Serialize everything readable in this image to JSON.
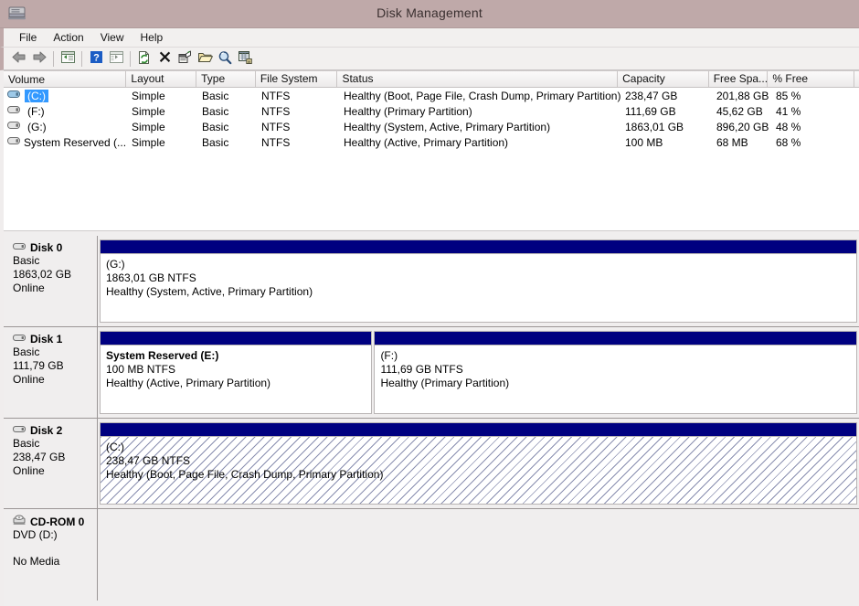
{
  "window": {
    "title": "Disk Management",
    "app_icon": "disk-management-icon"
  },
  "menubar": {
    "items": [
      {
        "label": "File",
        "name": "menu-file"
      },
      {
        "label": "Action",
        "name": "menu-action"
      },
      {
        "label": "View",
        "name": "menu-view"
      },
      {
        "label": "Help",
        "name": "menu-help"
      }
    ]
  },
  "toolbar": {
    "buttons": [
      {
        "icon": "back-arrow-icon",
        "name": "toolbar-back"
      },
      {
        "icon": "forward-arrow-icon",
        "name": "toolbar-forward"
      },
      {
        "sep": true
      },
      {
        "icon": "show-hide-tree-icon",
        "name": "toolbar-show-tree"
      },
      {
        "sep": true
      },
      {
        "icon": "help-icon",
        "name": "toolbar-help"
      },
      {
        "icon": "show-action-pane-icon",
        "name": "toolbar-action-pane"
      },
      {
        "sep": true
      },
      {
        "icon": "rescan-disks-icon",
        "name": "toolbar-rescan"
      },
      {
        "icon": "delete-icon",
        "name": "toolbar-delete"
      },
      {
        "icon": "properties-icon",
        "name": "toolbar-properties"
      },
      {
        "icon": "open-folder-icon",
        "name": "toolbar-open"
      },
      {
        "icon": "search-icon",
        "name": "toolbar-search"
      },
      {
        "icon": "export-list-icon",
        "name": "toolbar-export-list"
      }
    ]
  },
  "volume_list": {
    "columns": [
      {
        "label": "Volume",
        "name": "column-volume"
      },
      {
        "label": "Layout",
        "name": "column-layout"
      },
      {
        "label": "Type",
        "name": "column-type"
      },
      {
        "label": "File System",
        "name": "column-file-system"
      },
      {
        "label": "Status",
        "name": "column-status"
      },
      {
        "label": "Capacity",
        "name": "column-capacity"
      },
      {
        "label": "Free Spa...",
        "name": "column-free-space"
      },
      {
        "label": "% Free",
        "name": "column-percent-free"
      },
      {
        "label": "",
        "name": "column-filler"
      }
    ],
    "rows": [
      {
        "volume": "(C:)",
        "selected": true,
        "layout": "Simple",
        "type": "Basic",
        "file_system": "NTFS",
        "status": "Healthy (Boot, Page File, Crash Dump, Primary Partition)",
        "capacity": "238,47 GB",
        "free_space": "201,88 GB",
        "percent_free": "85 %"
      },
      {
        "volume": "(F:)",
        "selected": false,
        "layout": "Simple",
        "type": "Basic",
        "file_system": "NTFS",
        "status": "Healthy (Primary Partition)",
        "capacity": "111,69 GB",
        "free_space": "45,62 GB",
        "percent_free": "41 %"
      },
      {
        "volume": "(G:)",
        "selected": false,
        "layout": "Simple",
        "type": "Basic",
        "file_system": "NTFS",
        "status": "Healthy (System, Active, Primary Partition)",
        "capacity": "1863,01 GB",
        "free_space": "896,20 GB",
        "percent_free": "48 %"
      },
      {
        "volume": "System Reserved (...",
        "selected": false,
        "layout": "Simple",
        "type": "Basic",
        "file_system": "NTFS",
        "status": "Healthy (Active, Primary Partition)",
        "capacity": "100 MB",
        "free_space": "68 MB",
        "percent_free": "68 %"
      }
    ]
  },
  "graphical_view": {
    "disks": [
      {
        "name": "Disk 0",
        "icon": "disk-icon",
        "type": "Basic",
        "size": "1863,02 GB",
        "state": "Online",
        "partitions": [
          {
            "label": "(G:)",
            "label_bold": false,
            "size_fs": "1863,01 GB NTFS",
            "status": "Healthy (System, Active, Primary Partition)",
            "width_pct": 100,
            "hatched": false
          }
        ]
      },
      {
        "name": "Disk 1",
        "icon": "disk-icon",
        "type": "Basic",
        "size": "111,79 GB",
        "state": "Online",
        "partitions": [
          {
            "label": "System Reserved  (E:)",
            "label_bold": true,
            "size_fs": "100 MB NTFS",
            "status": "Healthy (Active, Primary Partition)",
            "width_pct": 36,
            "hatched": false
          },
          {
            "label": "(F:)",
            "label_bold": false,
            "size_fs": "111,69 GB NTFS",
            "status": "Healthy (Primary Partition)",
            "width_pct": 64,
            "hatched": false
          }
        ]
      },
      {
        "name": "Disk 2",
        "icon": "disk-icon",
        "type": "Basic",
        "size": "238,47 GB",
        "state": "Online",
        "partitions": [
          {
            "label": "(C:)",
            "label_bold": false,
            "size_fs": "238,47 GB NTFS",
            "status": "Healthy (Boot, Page File, Crash Dump, Primary Partition)",
            "width_pct": 100,
            "hatched": true
          }
        ]
      }
    ],
    "cdrom": {
      "name": "CD-ROM 0",
      "icon": "cdrom-icon",
      "media_label": "DVD (D:)",
      "state": "No Media"
    }
  },
  "colors": {
    "titlebar": "#bfa9a9",
    "partition_bar": "#000080",
    "selection": "#3399ff",
    "pane_bg": "#f0eeee"
  }
}
